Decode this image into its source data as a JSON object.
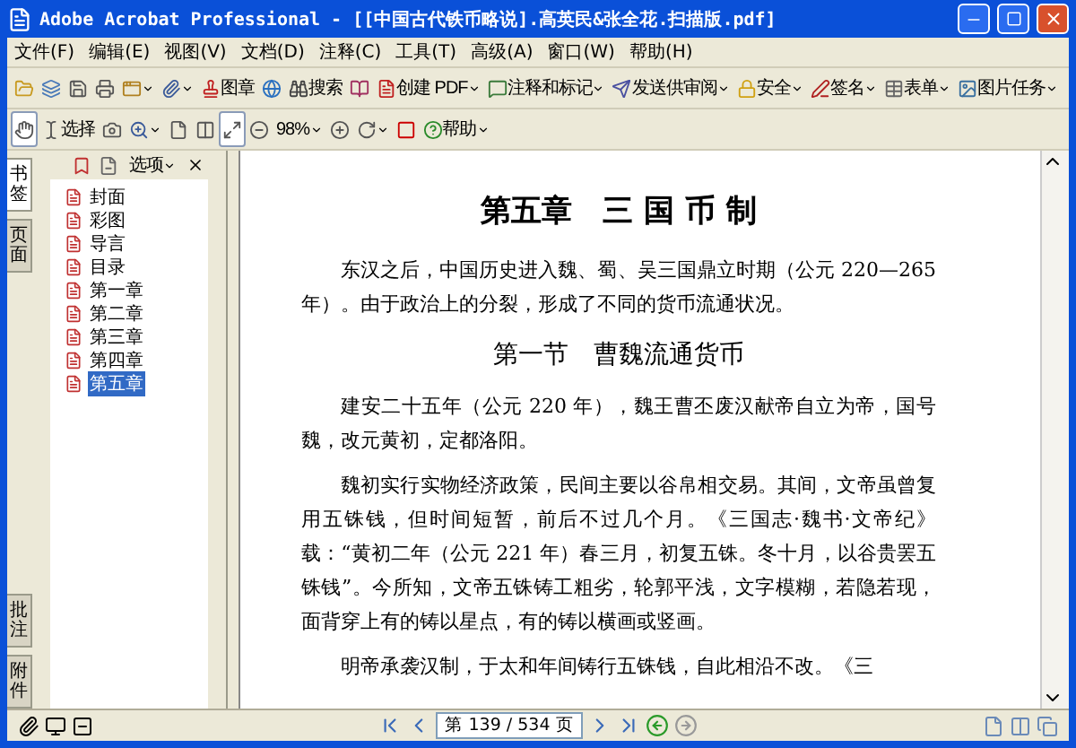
{
  "window": {
    "title": "Adobe Acrobat Professional - [[中国古代铁币略说].高英民&张全花.扫描版.pdf]"
  },
  "menu": [
    "文件(F)",
    "编辑(E)",
    "视图(V)",
    "文档(D)",
    "注释(C)",
    "工具(T)",
    "高级(A)",
    "窗口(W)",
    "帮助(H)"
  ],
  "toolbar_1": [
    {
      "kind": "icon",
      "menu": false
    },
    {
      "kind": "icon",
      "menu": false
    },
    {
      "kind": "icon",
      "menu": false
    },
    {
      "kind": "icon",
      "menu": false
    },
    {
      "kind": "icon",
      "menu": true
    },
    {
      "kind": "icon",
      "menu": true
    },
    {
      "kind": "labeled",
      "label": "图章",
      "menu": false
    },
    {
      "kind": "icon",
      "menu": false
    },
    {
      "kind": "labeled",
      "label": "搜索",
      "menu": false
    },
    {
      "kind": "icon",
      "menu": false
    },
    {
      "kind": "labeled",
      "label": "创建 PDF",
      "menu": true
    },
    {
      "kind": "labeled",
      "label": "注释和标记",
      "menu": true
    },
    {
      "kind": "labeled",
      "label": "发送供审阅",
      "menu": true
    },
    {
      "kind": "labeled",
      "label": "安全",
      "menu": true
    },
    {
      "kind": "labeled",
      "label": "签名",
      "menu": true
    },
    {
      "kind": "labeled",
      "label": "表单",
      "menu": true
    },
    {
      "kind": "labeled",
      "label": "图片任务",
      "menu": true
    }
  ],
  "toolbar_2": [
    {
      "kind": "icon",
      "pressed": true,
      "menu": false
    },
    {
      "kind": "labeled",
      "label": "选择",
      "pressed": false,
      "menu": false
    },
    {
      "kind": "icon",
      "pressed": false,
      "menu": false
    },
    {
      "kind": "icon",
      "pressed": false,
      "menu": true
    },
    {
      "kind": "icon",
      "pressed": false,
      "menu": false
    },
    {
      "kind": "icon",
      "pressed": false,
      "menu": false
    },
    {
      "kind": "icon",
      "pressed": true,
      "menu": false
    },
    {
      "kind": "icon",
      "pressed": false,
      "menu": false
    },
    {
      "kind": "zoom",
      "value": "98%",
      "menu": true
    },
    {
      "kind": "icon",
      "pressed": false,
      "menu": false
    },
    {
      "kind": "icon",
      "pressed": false,
      "menu": true
    },
    {
      "kind": "icon",
      "pressed": false,
      "menu": false
    },
    {
      "kind": "labeled",
      "label": "帮助",
      "pressed": false,
      "menu": true
    }
  ],
  "side_tabs": [
    {
      "label": "书签",
      "selected": true
    },
    {
      "label": "页面",
      "selected": false
    }
  ],
  "side_tabs_bottom": [
    {
      "label": "批注",
      "selected": false
    },
    {
      "label": "附件",
      "selected": false
    }
  ],
  "bookmarks_panel": {
    "options": "选项",
    "items": [
      {
        "label": "封面",
        "selected": false
      },
      {
        "label": "彩图",
        "selected": false
      },
      {
        "label": "导言",
        "selected": false
      },
      {
        "label": "目录",
        "selected": false
      },
      {
        "label": "第一章",
        "selected": false
      },
      {
        "label": "第二章",
        "selected": false
      },
      {
        "label": "第三章",
        "selected": false
      },
      {
        "label": "第四章",
        "selected": false
      },
      {
        "label": "第五章",
        "selected": true
      }
    ]
  },
  "document": {
    "blocks": [
      {
        "kind": "chapter",
        "text": "第五章　三 国 币 制"
      },
      {
        "kind": "paragraph",
        "text": "东汉之后，中国历史进入魏、蜀、吴三国鼎立时期（公元 220—265 年）。由于政治上的分裂，形成了不同的货币流通状况。"
      },
      {
        "kind": "section",
        "text": "第一节　曹魏流通货币"
      },
      {
        "kind": "paragraph",
        "text": "建安二十五年（公元 220 年），魏王曹丕废汉献帝自立为帝，国号魏，改元黄初，定都洛阳。"
      },
      {
        "kind": "paragraph",
        "text": "魏初实行实物经济政策，民间主要以谷帛相交易。其间，文帝虽曾复用五铢钱，但时间短暂，前后不过几个月。《三国志·魏书·文帝纪》载：“黄初二年（公元 221 年）春三月，初复五铢。冬十月，以谷贵罢五铢钱”。今所知，文帝五铢铸工粗劣，轮郭平浅，文字模糊，若隐若现，面背穿上有的铸以星点，有的铸以横画或竖画。"
      },
      {
        "kind": "paragraph",
        "text": "明帝承袭汉制，于太和年间铸行五铢钱，自此相沿不改。《三"
      }
    ]
  },
  "status_bar": {
    "page": "第 139 / 534 页"
  }
}
